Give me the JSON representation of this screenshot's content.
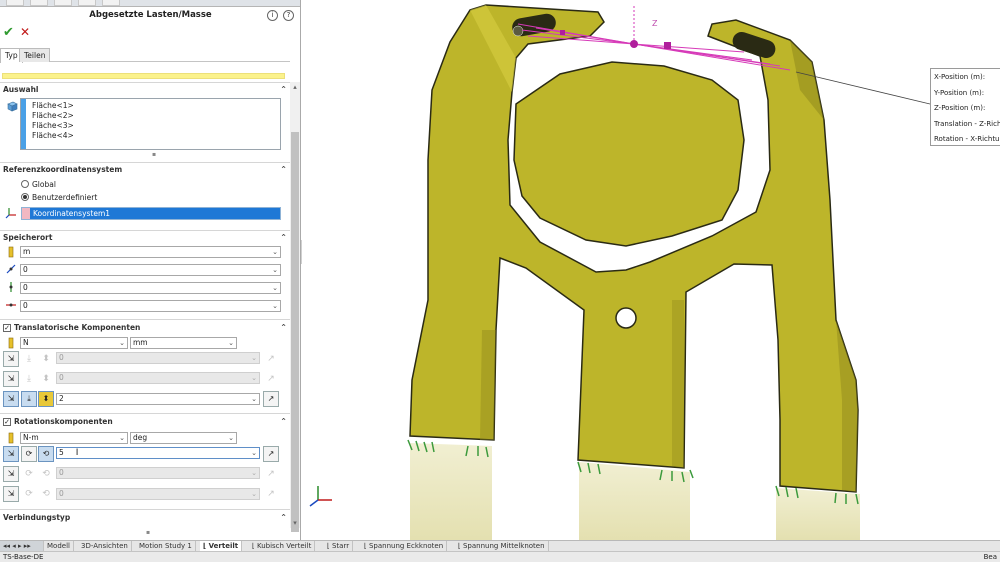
{
  "property_manager": {
    "title": "Abgesetzte Lasten/Masse",
    "help_icons": [
      "info-icon",
      "help-icon"
    ],
    "tabs": [
      {
        "label": "Typ",
        "active": true
      },
      {
        "label": "Teilen",
        "active": false
      }
    ],
    "sections": {
      "auswahl": {
        "title": "Auswahl",
        "faces": [
          "Fläche<1>",
          "Fläche<2>",
          "Fläche<3>",
          "Fläche<4>"
        ]
      },
      "referenz": {
        "title": "Referenzkoordinatensystem",
        "options": [
          {
            "label": "Global",
            "selected": false
          },
          {
            "label": "Benutzerdefiniert",
            "selected": true
          }
        ],
        "coordinate_system": "Koordinatensystem1"
      },
      "speicherort": {
        "title": "Speicherort",
        "unit": "m",
        "x": "0",
        "y": "0",
        "z": "0"
      },
      "translatorisch": {
        "title": "Translatorische Komponenten",
        "checked": true,
        "force_unit": "N",
        "length_unit": "mm",
        "rows": [
          {
            "value": "0",
            "enabled": false
          },
          {
            "value": "0",
            "enabled": false
          },
          {
            "value": "2",
            "enabled": true
          }
        ]
      },
      "rotation": {
        "title": "Rotationskomponenten",
        "checked": true,
        "moment_unit": "N-m",
        "angle_unit": "deg",
        "rows": [
          {
            "value": "5",
            "enabled": true
          },
          {
            "value": "0",
            "enabled": false
          },
          {
            "value": "0",
            "enabled": false
          }
        ]
      },
      "verbindungstyp": {
        "title": "Verbindungstyp"
      }
    }
  },
  "callout": {
    "lines": [
      "X-Position (m):",
      "Y-Position (m):",
      "Z-Position (m):",
      "Translation -  Z-Richt",
      "Rotation -  X-Richtun"
    ]
  },
  "triad_axis_label": "Z",
  "bottom_tabs": [
    {
      "label": "Modell",
      "active": false
    },
    {
      "label": "3D-Ansichten",
      "active": false
    },
    {
      "label": "Motion Study 1",
      "active": false
    },
    {
      "label": "Verteilt",
      "active": true
    },
    {
      "label": "Kubisch Verteilt",
      "active": false
    },
    {
      "label": "Starr",
      "active": false
    },
    {
      "label": "Spannung Eckknoten",
      "active": false
    },
    {
      "label": "Spannung Mittelknoten",
      "active": false
    }
  ],
  "status_bar": {
    "left": "TS-Base-DE",
    "right": "Bea"
  },
  "colors": {
    "part_fill": "#bdb52a",
    "part_edge": "#2a2a14",
    "selection_blue": "#1e78d6",
    "bar_blue": "#4aa0e6",
    "load_magenta": "#d63ab8",
    "fixture_green": "#3c9a3c"
  }
}
